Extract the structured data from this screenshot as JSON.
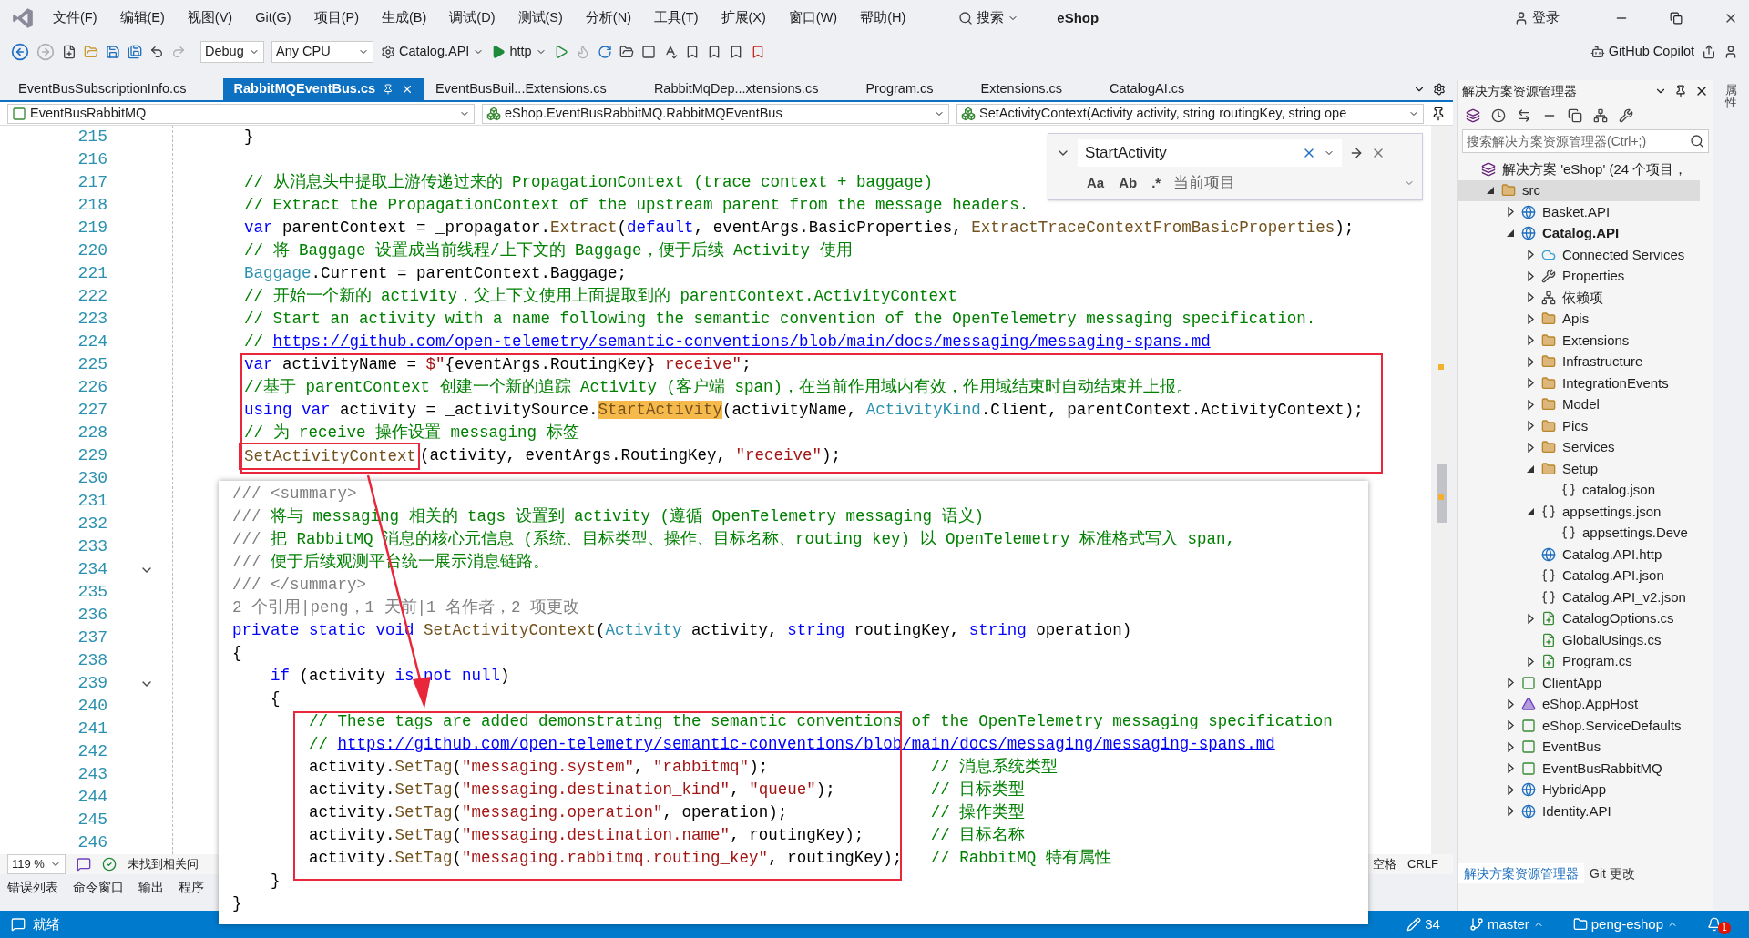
{
  "menu_bar": {
    "items": [
      "文件(F)",
      "编辑(E)",
      "视图(V)",
      "Git(G)",
      "项目(P)",
      "生成(B)",
      "调试(D)",
      "测试(S)",
      "分析(N)",
      "工具(T)",
      "扩展(X)",
      "窗口(W)",
      "帮助(H)"
    ],
    "search": "搜索",
    "solution": "eShop",
    "sign_in": "登录"
  },
  "toolbar": {
    "configuration": "Debug",
    "platform": "Any CPU",
    "startup_project": "Catalog.API",
    "launch_profile": "http",
    "copilot": "GitHub Copilot"
  },
  "tabs": [
    {
      "label": "EventBusSubscriptionInfo.cs",
      "selected": false
    },
    {
      "label": "RabbitMQEventBus.cs",
      "selected": true
    },
    {
      "label": "EventBusBuil...Extensions.cs",
      "selected": false
    },
    {
      "label": "RabbitMqDep...xtensions.cs",
      "selected": false
    },
    {
      "label": "Program.cs",
      "selected": false
    },
    {
      "label": "Extensions.cs",
      "selected": false
    },
    {
      "label": "CatalogAI.cs",
      "selected": false
    }
  ],
  "nav_bar": {
    "project": "EventBusRabbitMQ",
    "type": "eShop.EventBusRabbitMQ.RabbitMQEventBus",
    "member": "SetActivityContext(Activity activity, string routingKey, string ope"
  },
  "find_widget": {
    "query": "StartActivity",
    "scope": "当前项目",
    "options": [
      {
        "label": "Aa",
        "selected": false
      },
      {
        "label": "Ab",
        "selected": false
      },
      {
        "label": ".*",
        "selected": false
      }
    ]
  },
  "editor": {
    "lines": [
      {
        "number": "215",
        "tokens": [
          {
            "kind": "plain",
            "text": "}"
          }
        ]
      },
      {
        "number": "216"
      },
      {
        "number": "217",
        "tokens": [
          {
            "kind": "comment",
            "text": "// 从消息头中提取上游传递过来的 PropagationContext (trace context + baggage)"
          }
        ]
      },
      {
        "number": "218",
        "tokens": [
          {
            "kind": "comment",
            "text": "// Extract the PropagationContext of the upstream parent from the message headers."
          }
        ]
      },
      {
        "number": "219",
        "tokens": [
          {
            "kind": "keyword",
            "text": "var"
          },
          {
            "kind": "plain",
            "text": " parentContext = _propagator."
          },
          {
            "kind": "method",
            "text": "Extract"
          },
          {
            "kind": "plain",
            "text": "("
          },
          {
            "kind": "keyword",
            "text": "default"
          },
          {
            "kind": "plain",
            "text": ", eventArgs.BasicProperties, "
          },
          {
            "kind": "method",
            "text": "ExtractTraceContextFromBasicProperties"
          },
          {
            "kind": "plain",
            "text": ");"
          }
        ]
      },
      {
        "number": "220",
        "tokens": [
          {
            "kind": "comment",
            "text": "// 将 Baggage 设置成当前线程/上下文的 Baggage，便于后续 Activity 使用"
          }
        ]
      },
      {
        "number": "221",
        "tokens": [
          {
            "kind": "type",
            "text": "Baggage"
          },
          {
            "kind": "plain",
            "text": ".Current = parentContext.Baggage;"
          }
        ]
      },
      {
        "number": "222",
        "tokens": [
          {
            "kind": "comment",
            "text": "// 开始一个新的 activity，父上下文使用上面提取到的 parentContext.ActivityContext"
          }
        ]
      },
      {
        "number": "223",
        "tokens": [
          {
            "kind": "comment",
            "text": "// Start an activity with a name following the semantic convention of the OpenTelemetry messaging specification."
          }
        ]
      },
      {
        "number": "224",
        "tokens": [
          {
            "kind": "comment",
            "text": "//"
          },
          {
            "kind": "link",
            "text": "https://github.com/open-telemetry/semantic-conventions/blob/main/docs/messaging/messaging-spans.md"
          }
        ]
      },
      {
        "number": "225",
        "tokens": [
          {
            "kind": "keyword",
            "text": "var"
          },
          {
            "kind": "plain",
            "text": " activityName = "
          },
          {
            "kind": "string",
            "text": "$\""
          },
          {
            "kind": "plain",
            "text": "{eventArgs.RoutingKey}"
          },
          {
            "kind": "string",
            "text": " receive\""
          },
          {
            "kind": "plain",
            "text": ";"
          }
        ]
      },
      {
        "number": "226",
        "tokens": [
          {
            "kind": "comment",
            "text": "//基于 parentContext 创建一个新的追踪 Activity (客户端 span)，在当前作用域内有效，作用域结束时自动结束并上报。"
          }
        ]
      },
      {
        "number": "227",
        "tokens": [
          {
            "kind": "keyword",
            "text": "using var"
          },
          {
            "kind": "plain",
            "text": " activity = _activitySource."
          },
          {
            "kind": "match",
            "text": "StartActivity"
          },
          {
            "kind": "plain",
            "text": "(activityName, "
          },
          {
            "kind": "type",
            "text": "ActivityKind"
          },
          {
            "kind": "plain",
            "text": ".Client, parentContext.ActivityContext);"
          }
        ]
      },
      {
        "number": "228",
        "tokens": [
          {
            "kind": "comment",
            "text": "// 为 receive 操作设置 messaging 标签"
          }
        ]
      },
      {
        "number": "229",
        "tokens": [
          {
            "kind": "method",
            "text": "SetActivityContext",
            "boxed": true
          },
          {
            "kind": "plain",
            "text": "(activity, eventArgs.RoutingKey, "
          },
          {
            "kind": "string",
            "text": "\"receive\""
          },
          {
            "kind": "plain",
            "text": ");"
          }
        ]
      },
      {
        "number": "230"
      },
      {
        "number": "231"
      },
      {
        "number": "232"
      },
      {
        "number": "233"
      },
      {
        "number": "234",
        "fold": true
      },
      {
        "number": "235"
      },
      {
        "number": "236"
      },
      {
        "number": "237"
      },
      {
        "number": "238"
      },
      {
        "number": "239",
        "fold": true
      },
      {
        "number": "240"
      },
      {
        "number": "241"
      },
      {
        "number": "242"
      },
      {
        "number": "243"
      },
      {
        "number": "244"
      },
      {
        "number": "245"
      },
      {
        "number": "246"
      }
    ],
    "zoom": "119 %",
    "issues": "未找到相关问",
    "indent": "空格",
    "line_ending": "CRLF"
  },
  "snippet": {
    "lines": [
      {
        "tokens": [
          {
            "kind": "doc",
            "text": "/// <summary>"
          }
        ]
      },
      {
        "tokens": [
          {
            "kind": "doc",
            "text": "///"
          },
          {
            "kind": "comment",
            "text": " 将与 messaging 相关的 tags 设置到 activity (遵循 OpenTelemetry messaging 语义)"
          }
        ]
      },
      {
        "tokens": [
          {
            "kind": "doc",
            "text": "///"
          },
          {
            "kind": "comment",
            "text": " 把 RabbitMQ 消息的核心元信息 (系统、目标类型、操作、目标名称、routing key) 以 OpenTelemetry 标准格式写入 span,"
          }
        ]
      },
      {
        "tokens": [
          {
            "kind": "doc",
            "text": "///"
          },
          {
            "kind": "comment",
            "text": " 便于后续观测平台统一展示消息链路。"
          }
        ]
      },
      {
        "tokens": [
          {
            "kind": "doc",
            "text": "/// </summary>"
          }
        ]
      },
      {
        "tokens": [
          {
            "kind": "doc",
            "text": "2 个引用|peng，1 天前|1 名作者，2 项更改"
          }
        ]
      },
      {
        "tokens": [
          {
            "kind": "keyword",
            "text": "private static void "
          },
          {
            "kind": "method",
            "text": "SetActivityContext"
          },
          {
            "kind": "plain",
            "text": "("
          },
          {
            "kind": "type",
            "text": "Activity"
          },
          {
            "kind": "plain",
            "text": " activity, "
          },
          {
            "kind": "keyword",
            "text": "string"
          },
          {
            "kind": "plain",
            "text": " routingKey, "
          },
          {
            "kind": "keyword",
            "text": "string"
          },
          {
            "kind": "plain",
            "text": " operation)"
          }
        ]
      },
      {
        "tokens": [
          {
            "kind": "plain",
            "text": "{"
          }
        ]
      },
      {
        "tokens": [
          {
            "kind": "keyword",
            "text": "    if"
          },
          {
            "kind": "plain",
            "text": " (activity "
          },
          {
            "kind": "keyword",
            "text": "is not null"
          },
          {
            "kind": "plain",
            "text": ")"
          }
        ]
      },
      {
        "tokens": [
          {
            "kind": "plain",
            "text": "    {"
          }
        ]
      },
      {
        "tokens": [
          {
            "kind": "comment",
            "text": "        // These tags are added demonstrating the semantic conventions of the OpenTelemetry messaging specification"
          }
        ]
      },
      {
        "tokens": [
          {
            "kind": "comment",
            "text": "        //"
          },
          {
            "kind": "link",
            "text": "https://github.com/open-telemetry/semantic-conventions/blob/main/docs/messaging/messaging-spans.md"
          }
        ]
      },
      {
        "tokens": [
          {
            "kind": "plain",
            "text": "        activity."
          },
          {
            "kind": "method",
            "text": "SetTag"
          },
          {
            "kind": "plain",
            "text": "("
          },
          {
            "kind": "string",
            "text": "\"messaging.system\""
          },
          {
            "kind": "plain",
            "text": ", "
          },
          {
            "kind": "string",
            "text": "\"rabbitmq\""
          },
          {
            "kind": "plain",
            "text": ");                 "
          },
          {
            "kind": "comment",
            "text": "// 消息系统类型"
          }
        ]
      },
      {
        "tokens": [
          {
            "kind": "plain",
            "text": "        activity."
          },
          {
            "kind": "method",
            "text": "SetTag"
          },
          {
            "kind": "plain",
            "text": "("
          },
          {
            "kind": "string",
            "text": "\"messaging.destination_kind\""
          },
          {
            "kind": "plain",
            "text": ", "
          },
          {
            "kind": "string",
            "text": "\"queue\""
          },
          {
            "kind": "plain",
            "text": ");          "
          },
          {
            "kind": "comment",
            "text": "// 目标类型"
          }
        ]
      },
      {
        "tokens": [
          {
            "kind": "plain",
            "text": "        activity."
          },
          {
            "kind": "method",
            "text": "SetTag"
          },
          {
            "kind": "plain",
            "text": "("
          },
          {
            "kind": "string",
            "text": "\"messaging.operation\""
          },
          {
            "kind": "plain",
            "text": ", operation);               "
          },
          {
            "kind": "comment",
            "text": "// 操作类型"
          }
        ]
      },
      {
        "tokens": [
          {
            "kind": "plain",
            "text": "        activity."
          },
          {
            "kind": "method",
            "text": "SetTag"
          },
          {
            "kind": "plain",
            "text": "("
          },
          {
            "kind": "string",
            "text": "\"messaging.destination.name\""
          },
          {
            "kind": "plain",
            "text": ", routingKey);       "
          },
          {
            "kind": "comment",
            "text": "// 目标名称"
          }
        ]
      },
      {
        "tokens": [
          {
            "kind": "plain",
            "text": "        activity."
          },
          {
            "kind": "method",
            "text": "SetTag"
          },
          {
            "kind": "plain",
            "text": "("
          },
          {
            "kind": "string",
            "text": "\"messaging.rabbitmq.routing_key\""
          },
          {
            "kind": "plain",
            "text": ", routingKey);   "
          },
          {
            "kind": "comment",
            "text": "// RabbitMQ 特有属性"
          }
        ]
      },
      {
        "tokens": [
          {
            "kind": "plain",
            "text": "    }"
          }
        ]
      },
      {
        "tokens": [
          {
            "kind": "plain",
            "text": "}"
          }
        ]
      }
    ]
  },
  "tool_tabs": [
    "错误列表",
    "命令窗口",
    "输出",
    "程序"
  ],
  "solution_explorer": {
    "title": "解决方案资源管理器",
    "search_placeholder": "搜索解决方案资源管理器(Ctrl+;)",
    "tree": [
      {
        "label": "解决方案 'eShop' (24 个项目，",
        "kind": "solution",
        "selected": false,
        "children": [
          {
            "label": "src",
            "kind": "folder",
            "selected": true,
            "expanded": true,
            "children": [
              {
                "label": "Basket.API",
                "kind": "web",
                "selected": false,
                "expanded": false,
                "startup": false
              },
              {
                "label": "Catalog.API",
                "kind": "web",
                "selected": false,
                "expanded": true,
                "startup": true,
                "children": [
                  {
                    "label": "Connected Services",
                    "kind": "cloud",
                    "selected": false,
                    "expanded": false
                  },
                  {
                    "label": "Properties",
                    "kind": "wrench",
                    "selected": false,
                    "expanded": false
                  },
                  {
                    "label": "依赖项",
                    "kind": "deps",
                    "selected": false,
                    "expanded": false
                  },
                  {
                    "label": "Apis",
                    "kind": "folder",
                    "selected": false,
                    "expanded": false
                  },
                  {
                    "label": "Extensions",
                    "kind": "folder",
                    "selected": false,
                    "expanded": false
                  },
                  {
                    "label": "Infrastructure",
                    "kind": "folder",
                    "selected": false,
                    "expanded": false
                  },
                  {
                    "label": "IntegrationEvents",
                    "kind": "folder",
                    "selected": false,
                    "expanded": false
                  },
                  {
                    "label": "Model",
                    "kind": "folder",
                    "selected": false,
                    "expanded": false
                  },
                  {
                    "label": "Pics",
                    "kind": "folder",
                    "selected": false,
                    "expanded": false
                  },
                  {
                    "label": "Services",
                    "kind": "folder",
                    "selected": false,
                    "expanded": false
                  },
                  {
                    "label": "Setup",
                    "kind": "folder",
                    "selected": false,
                    "expanded": true,
                    "children": [
                      {
                        "label": "catalog.json",
                        "kind": "json",
                        "selected": false
                      }
                    ]
                  },
                  {
                    "label": "appsettings.json",
                    "kind": "json",
                    "selected": false,
                    "expanded": true,
                    "children": [
                      {
                        "label": "appsettings.Deve",
                        "kind": "json",
                        "selected": false
                      }
                    ]
                  },
                  {
                    "label": "Catalog.API.http",
                    "kind": "http",
                    "selected": false
                  },
                  {
                    "label": "Catalog.API.json",
                    "kind": "json",
                    "selected": false
                  },
                  {
                    "label": "Catalog.API_v2.json",
                    "kind": "json",
                    "selected": false
                  },
                  {
                    "label": "CatalogOptions.cs",
                    "kind": "cs",
                    "selected": false,
                    "expanded": false
                  },
                  {
                    "label": "GlobalUsings.cs",
                    "kind": "cs",
                    "selected": false
                  },
                  {
                    "label": "Program.cs",
                    "kind": "cs",
                    "selected": false,
                    "expanded": false
                  }
                ]
              },
              {
                "label": "ClientApp",
                "kind": "csproj",
                "selected": false,
                "expanded": false,
                "startup": false
              },
              {
                "label": "eShop.AppHost",
                "kind": "apphost",
                "selected": false,
                "expanded": false,
                "startup": false
              },
              {
                "label": "eShop.ServiceDefaults",
                "kind": "csproj",
                "selected": false,
                "expanded": false,
                "startup": false
              },
              {
                "label": "EventBus",
                "kind": "csproj",
                "selected": false,
                "expanded": false,
                "startup": false
              },
              {
                "label": "EventBusRabbitMQ",
                "kind": "csproj",
                "selected": false,
                "expanded": false,
                "startup": false
              },
              {
                "label": "HybridApp",
                "kind": "web",
                "selected": false,
                "expanded": false,
                "startup": false
              },
              {
                "label": "Identity.API",
                "kind": "web",
                "selected": false,
                "expanded": false,
                "startup": false
              }
            ]
          }
        ]
      }
    ],
    "tabs": [
      {
        "label": "解决方案资源管理器",
        "selected": true
      },
      {
        "label": "Git 更改",
        "selected": false
      }
    ]
  },
  "side_tab": "属性",
  "status_bar": {
    "status": "就绪",
    "changes": "34",
    "branch": "master",
    "repository": "peng-eshop",
    "notifications": "1"
  }
}
